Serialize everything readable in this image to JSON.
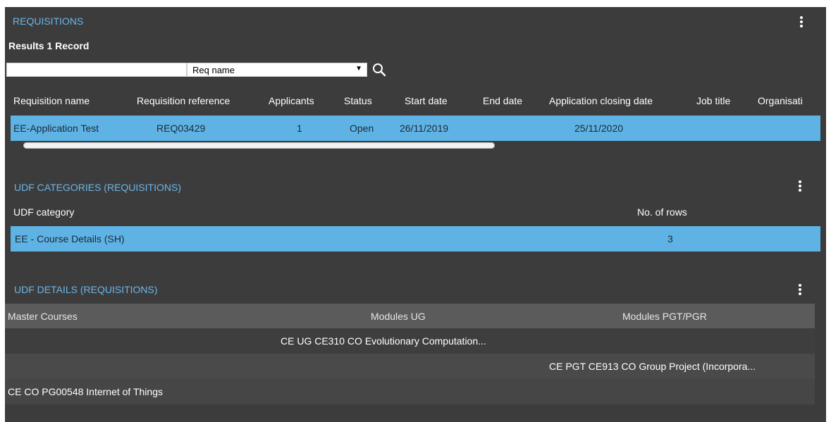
{
  "requisitions": {
    "title": "REQUISITIONS",
    "results_label": "Results 1 Record",
    "search": {
      "value": "",
      "select_value": "Req name"
    },
    "columns": [
      "Requisition name",
      "Requisition reference",
      "Applicants",
      "Status",
      "Start date",
      "End date",
      "Application closing date",
      "Job title",
      "Organisati"
    ],
    "row": {
      "name": "EE-Application Test",
      "reference": "REQ03429",
      "applicants": "1",
      "status": "Open",
      "start_date": "26/11/2019",
      "end_date": "",
      "closing_date": "25/11/2020",
      "job_title": "",
      "organisation": ""
    }
  },
  "udf_categories": {
    "title": "UDF CATEGORIES (REQUISITIONS)",
    "columns": [
      "UDF category",
      "No. of rows"
    ],
    "row": {
      "category": "EE - Course Details (SH)",
      "rows": "3"
    }
  },
  "udf_details": {
    "title": "UDF DETAILS (REQUISITIONS)",
    "columns": [
      "Master Courses",
      "Modules UG",
      "Modules PGT/PGR"
    ],
    "rows": [
      {
        "master": "",
        "ug": "CE UG CE310 CO Evolutionary Computation...",
        "pgt": ""
      },
      {
        "master": "",
        "ug": "",
        "pgt": "CE PGT CE913 CO Group Project (Incorpora..."
      },
      {
        "master": "CE CO PG00548 Internet of Things",
        "ug": "",
        "pgt": ""
      }
    ]
  },
  "colors": {
    "panel_bg": "#3c3c3c",
    "accent_title": "#6ab6e8",
    "selected_row": "#5fb3e4",
    "header_bar": "#5b5b5b"
  },
  "icons": [
    "more-vertical-icon",
    "search-icon",
    "caret-down-icon"
  ]
}
